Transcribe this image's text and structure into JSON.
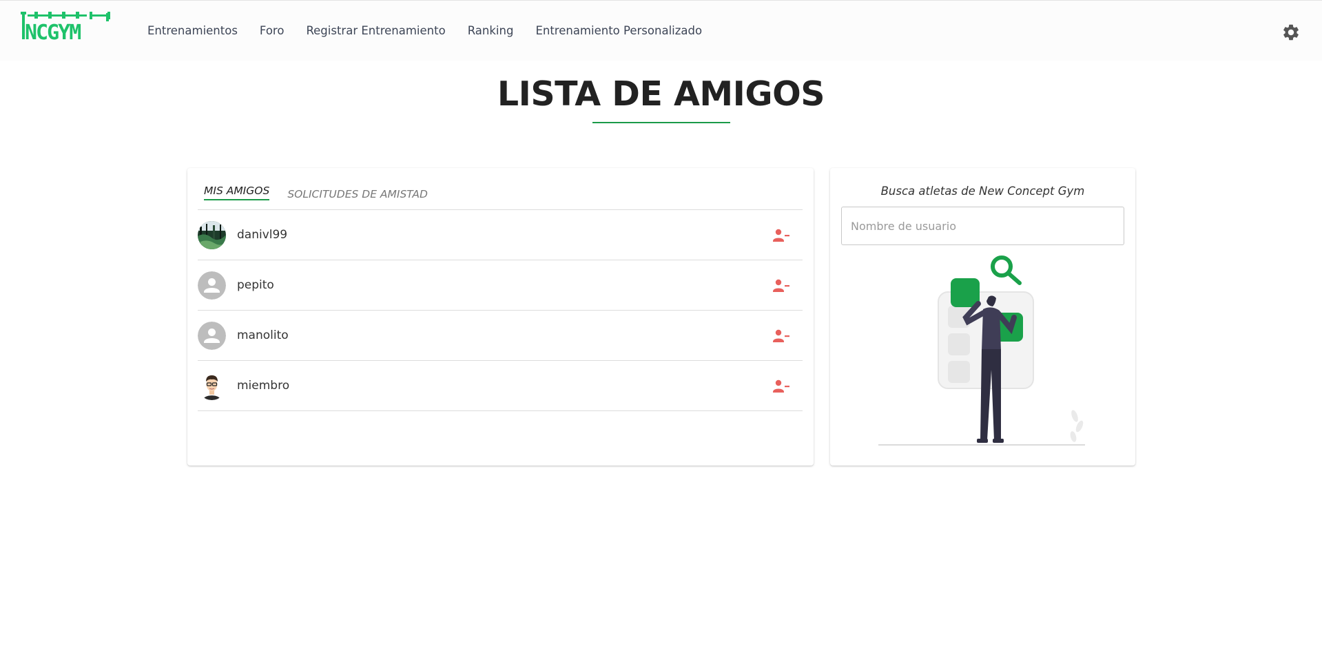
{
  "brand": {
    "logo_text": "NCGYM",
    "accent": "#1a9a48",
    "logo_color": "#1ec26a"
  },
  "nav": {
    "items": [
      {
        "label": "Entrenamientos"
      },
      {
        "label": "Foro"
      },
      {
        "label": "Registrar Entrenamiento"
      },
      {
        "label": "Ranking"
      },
      {
        "label": "Entrenamiento Personalizado"
      }
    ],
    "settings_icon": "gear-icon"
  },
  "page": {
    "title": "LISTA DE AMIGOS"
  },
  "friends_card": {
    "tabs": [
      {
        "label": "MIS AMIGOS",
        "active": true
      },
      {
        "label": "SOLICITUDES DE AMISTAD",
        "active": false
      }
    ],
    "friends": [
      {
        "username": "danivl99",
        "avatar": "photo-avatar"
      },
      {
        "username": "pepito",
        "avatar": "default-avatar"
      },
      {
        "username": "manolito",
        "avatar": "default-avatar"
      },
      {
        "username": "miembro",
        "avatar": "cartoon-avatar"
      }
    ],
    "remove_icon": "remove-user-icon",
    "remove_color": "#e8605c"
  },
  "search_card": {
    "title": "Busca atletas de New Concept Gym",
    "input": {
      "placeholder": "Nombre de usuario",
      "value": ""
    }
  }
}
